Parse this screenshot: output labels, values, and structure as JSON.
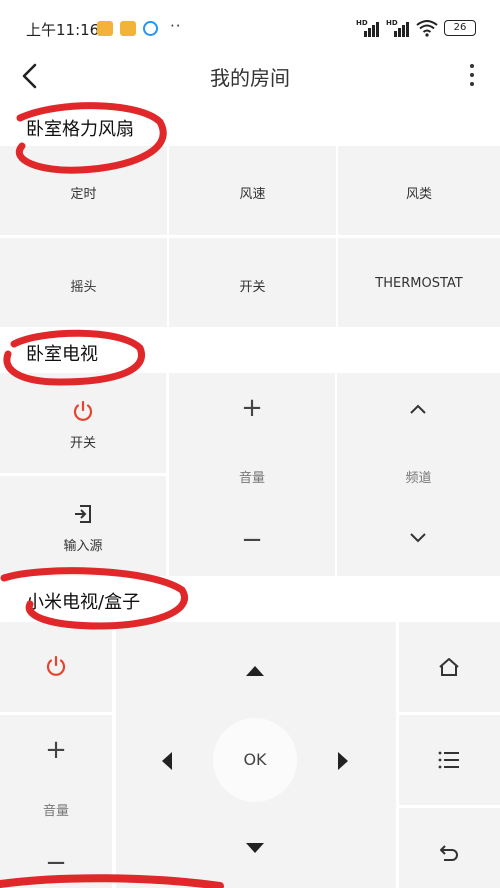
{
  "status_bar": {
    "time": "上午11:16",
    "dots": "··",
    "signal1_label": "HD",
    "signal2_label": "HD",
    "battery": "26"
  },
  "header": {
    "title": "我的房间",
    "back_icon": "chevron-left-icon",
    "more_icon": "more-vertical-icon"
  },
  "fan": {
    "title": "卧室格力风扇",
    "buttons": [
      "定时",
      "风速",
      "风类",
      "摇头",
      "开关",
      "THERMOSTAT"
    ]
  },
  "tv": {
    "title": "卧室电视",
    "power_label": "开关",
    "input_label": "输入源",
    "volume_label": "音量",
    "channel_label": "频道"
  },
  "box": {
    "title": "小米电视/盒子",
    "volume_label": "音量",
    "ok_label": "OK"
  },
  "colors": {
    "power_red": "#e5452e",
    "cell_bg": "#f3f3f3",
    "annotation_red": "#e0282a"
  }
}
